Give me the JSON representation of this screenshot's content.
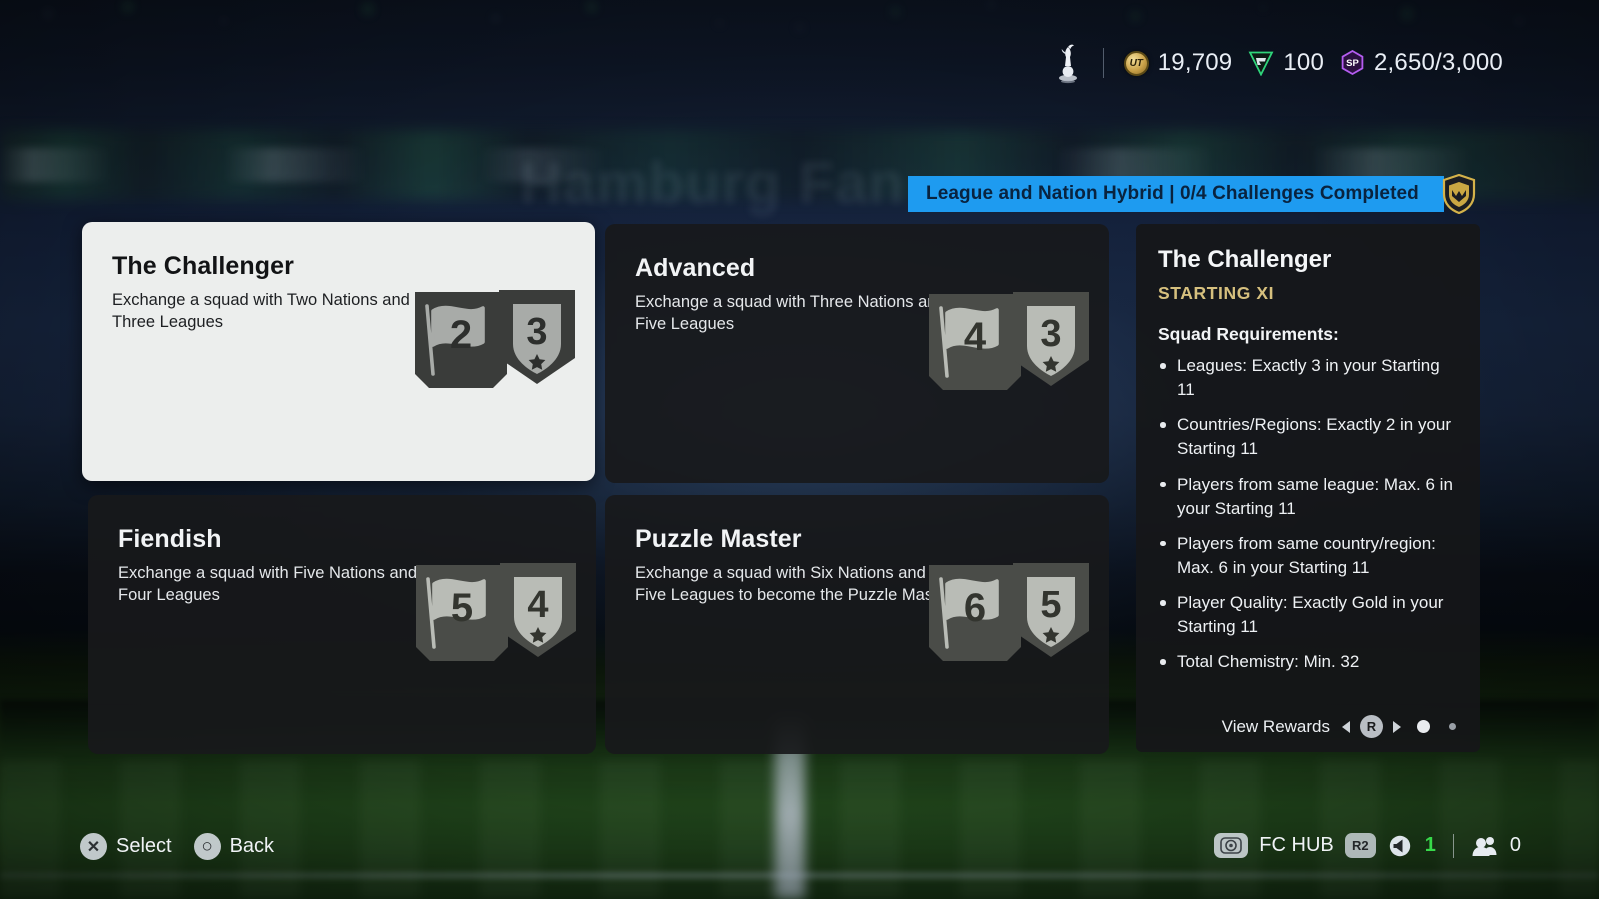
{
  "topbar": {
    "club_crest": "tottenham-cockerel-crest",
    "currencies": [
      {
        "icon": "ut-coin-icon",
        "icon_label": "UT",
        "value": "19,709"
      },
      {
        "icon": "fc-points-icon",
        "value": "100"
      },
      {
        "icon": "season-points-icon",
        "icon_label": "SP",
        "value": "2,650/3,000"
      }
    ]
  },
  "banner": {
    "text": "League and Nation Hybrid | 0/4 Challenges Completed",
    "badge_icon": "sbc-shield-badge-icon",
    "accent_color": "#1e9bf0"
  },
  "cards": [
    {
      "title": "The Challenger",
      "desc": "Exchange a squad with Two Nations and Three Leagues",
      "flag_number": "2",
      "shield_number": "3",
      "selected": true
    },
    {
      "title": "Advanced",
      "desc": "Exchange a squad with Three Nations and Five Leagues",
      "flag_number": "4",
      "shield_number": "3",
      "selected": false
    },
    {
      "title": "Fiendish",
      "desc": "Exchange a squad with Five Nations and Four Leagues",
      "flag_number": "5",
      "shield_number": "4",
      "selected": false
    },
    {
      "title": "Puzzle Master",
      "desc": "Exchange a squad with Six Nations and Five Leagues to become the Puzzle Master",
      "flag_number": "6",
      "shield_number": "5",
      "selected": false
    }
  ],
  "panel": {
    "title": "The Challenger",
    "subtitle": "STARTING XI",
    "subtitle_color": "#d6c07e",
    "requirements_heading": "Squad Requirements:",
    "requirements": [
      "Leagues: Exactly 3 in your Starting 11",
      "Countries/Regions: Exactly 2 in your Starting 11",
      "Players from same league: Max. 6 in your Starting 11",
      "Players from same country/region: Max. 6 in your Starting 11",
      "Player Quality: Exactly Gold in your Starting 11",
      "Total Chemistry: Min. 32"
    ],
    "footer": {
      "view_rewards_label": "View Rewards",
      "left_arrow_icon": "chevron-left-icon",
      "button_label": "R",
      "right_arrow_icon": "chevron-right-icon",
      "page_dots": 2,
      "active_dot": 0
    }
  },
  "bottom_bar": {
    "left_actions": [
      {
        "button_glyph": "✕",
        "icon_name": "cross-button-icon",
        "label": "Select"
      },
      {
        "button_glyph": "○",
        "icon_name": "circle-button-icon",
        "label": "Back"
      }
    ],
    "right_items": {
      "hub_icon": "touchpad-icon",
      "hub_label": "FC HUB",
      "r2_label": "R2",
      "volume_icon": "speaker-icon",
      "volume_value": "1",
      "volume_color": "#37d94a",
      "friends_icon": "friends-icon",
      "friends_value": "0"
    }
  },
  "background": {
    "stadium_title_text": "Hamburg Fan"
  }
}
